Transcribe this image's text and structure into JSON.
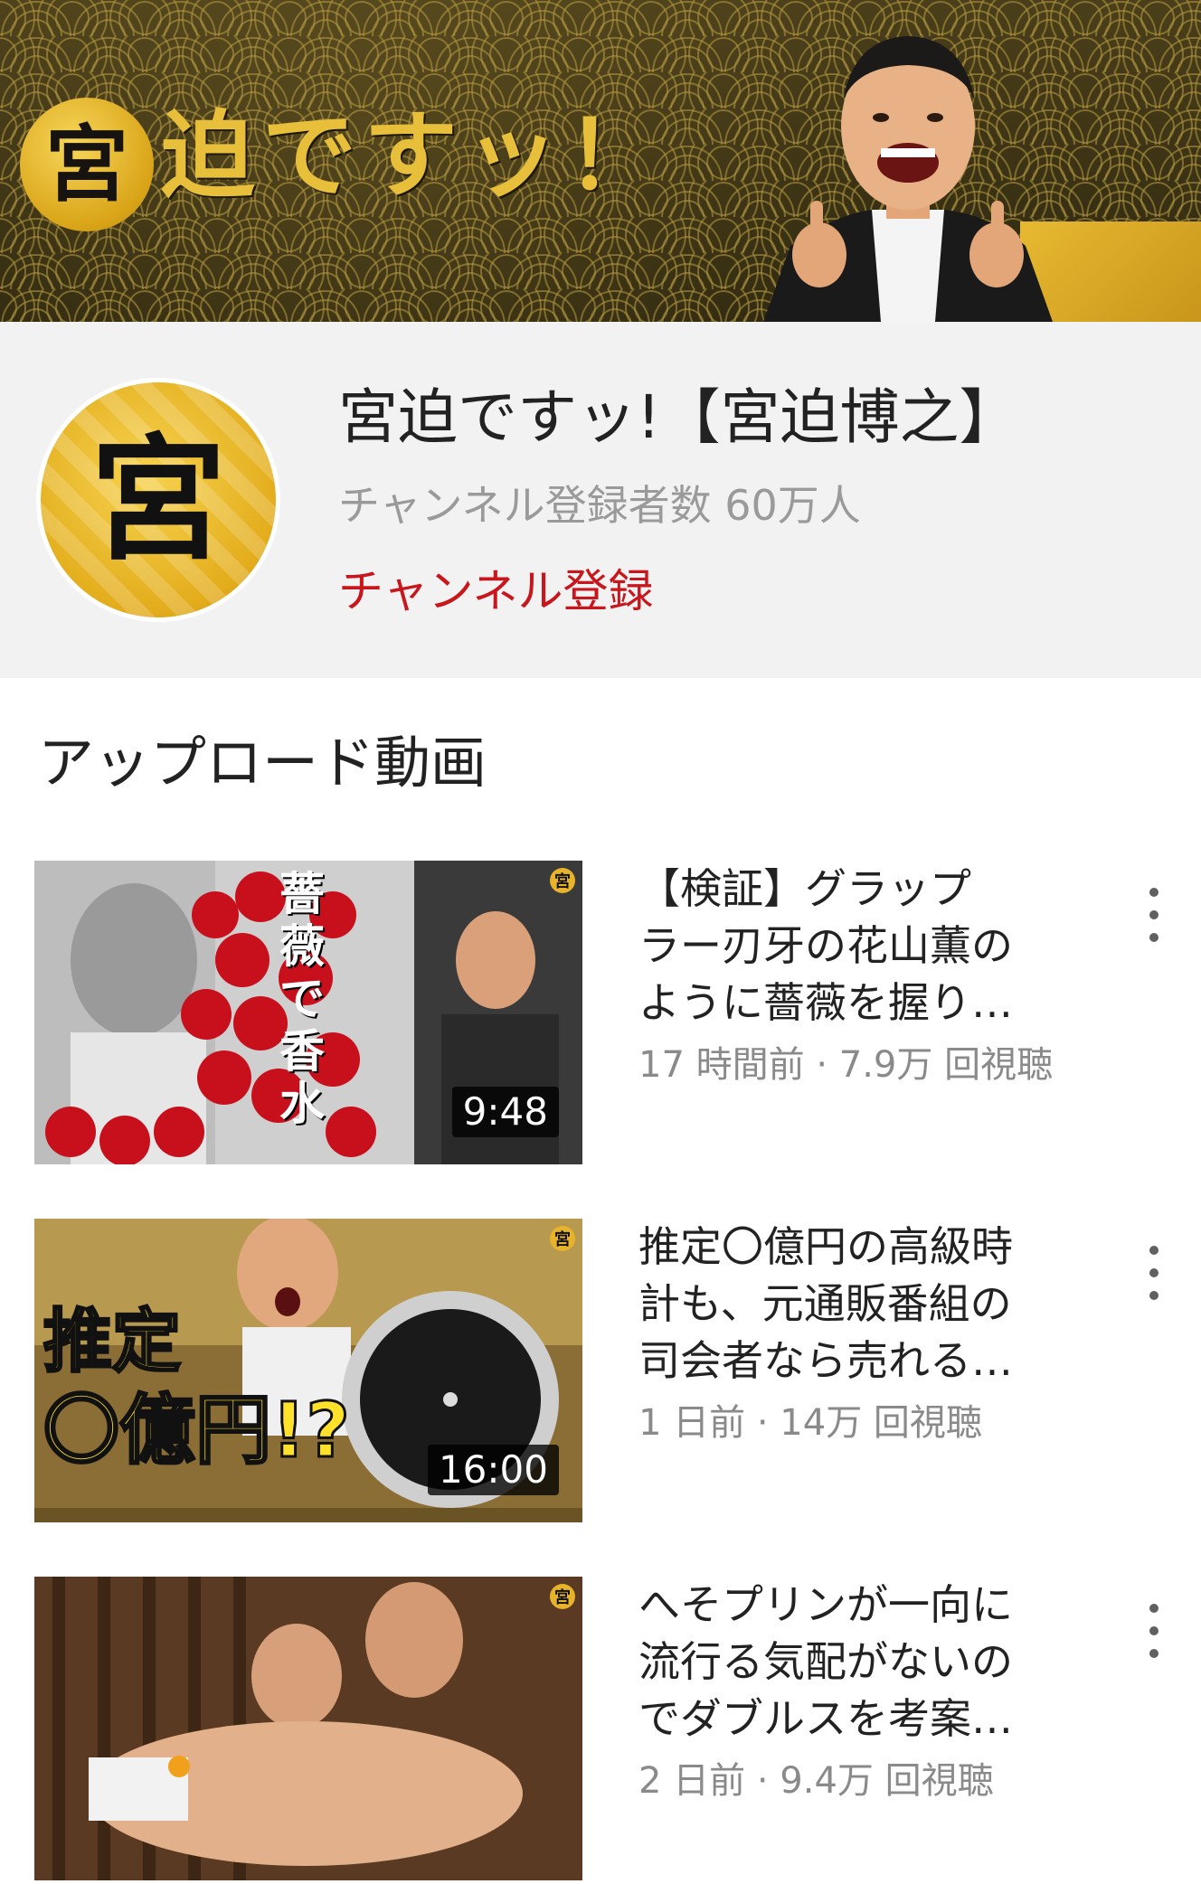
{
  "banner": {
    "logo_char": "宮",
    "title": "迫ですッ！"
  },
  "channel": {
    "avatar_char": "宮",
    "name": "宮迫ですッ!【宮迫博之】",
    "subscribers": "チャンネル登録者数 60万人",
    "subscribe_label": "チャンネル登録"
  },
  "section": {
    "title": "アップロード動画"
  },
  "videos": [
    {
      "title_lines": [
        "【検証】グラップ",
        "ラー刃牙の花山薫の",
        "ように薔薇を握り…"
      ],
      "meta": "17 時間前 · 7.9万 回視聴",
      "duration": "9:48",
      "thumb_text": "薔薇で香水",
      "badge": "宮"
    },
    {
      "title_lines": [
        "推定〇億円の高級時",
        "計も、元通販番組の",
        "司会者なら売れる…"
      ],
      "meta": "1 日前 · 14万 回視聴",
      "duration": "16:00",
      "thumb_text_1": "推定",
      "thumb_text_2": "〇億円!?",
      "badge": "宮"
    },
    {
      "title_lines": [
        "へそプリンが一向に",
        "流行る気配がないの",
        "でダブルスを考案…"
      ],
      "meta": "2 日前 · 9.4万 回視聴",
      "badge": "宮"
    }
  ],
  "colors": {
    "accent_red": "#c8161d",
    "gold": "#e3ad1c"
  }
}
